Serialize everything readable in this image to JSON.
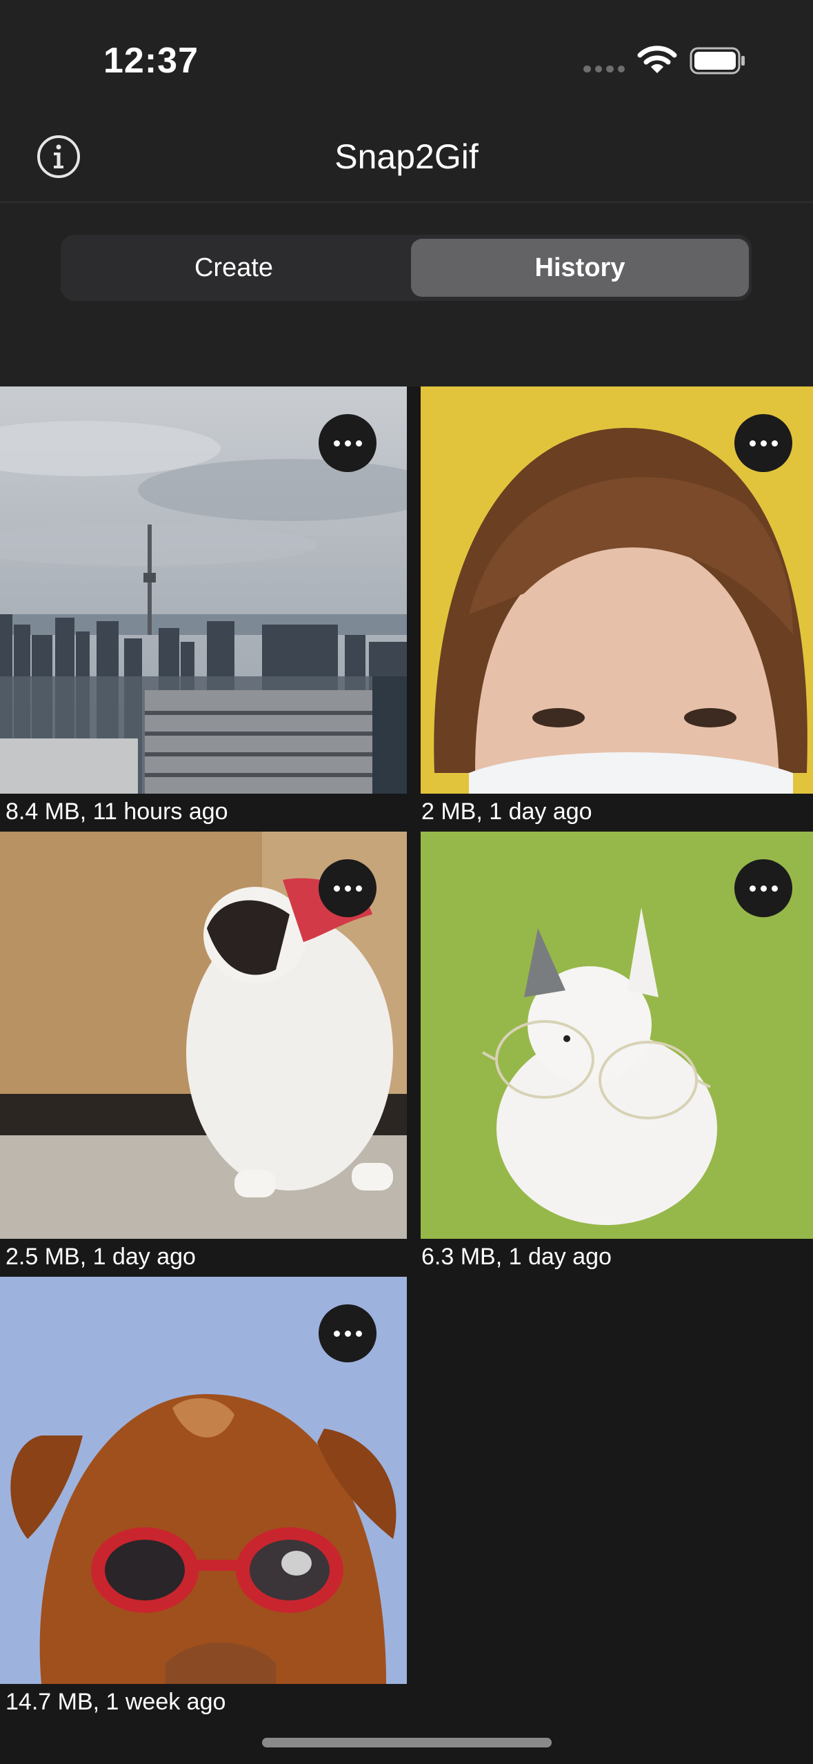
{
  "status_bar": {
    "time": "12:37",
    "signal_icon": "cellular-signal-icon",
    "wifi_icon": "wifi-icon",
    "battery_icon": "battery-icon"
  },
  "nav": {
    "title": "Snap2Gif",
    "info_icon": "info-icon"
  },
  "segmented": {
    "options": [
      "Create",
      "History"
    ],
    "selected": "History"
  },
  "history": {
    "items": [
      {
        "caption": "8.4 MB, 11 hours ago",
        "thumbnail": "city-skyline"
      },
      {
        "caption": "2 MB, 1 day ago",
        "thumbnail": "woman-with-mask"
      },
      {
        "caption": "2.5 MB, 1 day ago",
        "thumbnail": "cat-with-scarf"
      },
      {
        "caption": "6.3 MB, 1 day ago",
        "thumbnail": "rabbit-with-glasses"
      },
      {
        "caption": "14.7 MB, 1 week ago",
        "thumbnail": "dog-with-goggles"
      }
    ],
    "more_icon": "ellipsis-icon"
  },
  "colors": {
    "background": "#181818",
    "bar": "#222222",
    "segment_selected": "#636366"
  }
}
